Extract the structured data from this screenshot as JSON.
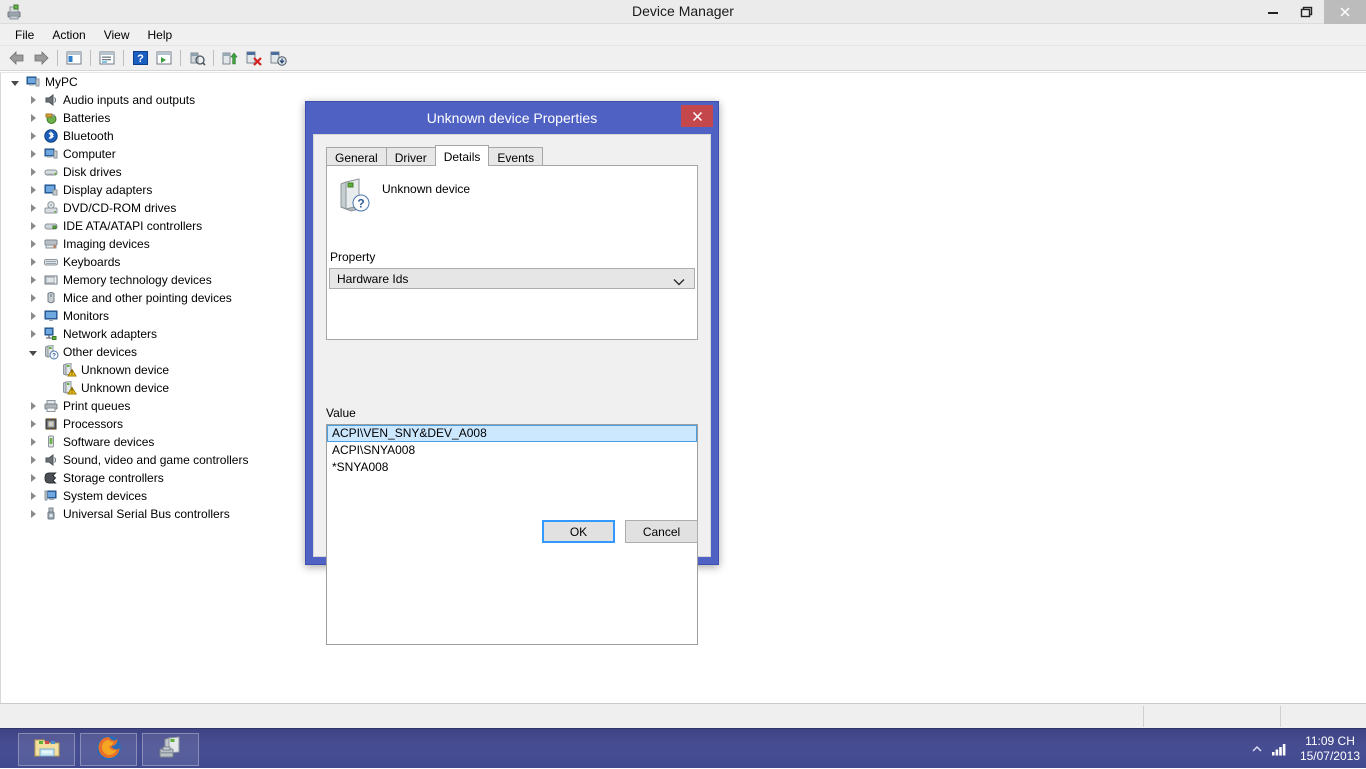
{
  "window": {
    "title": "Device Manager",
    "app_icon": "device-manager-icon",
    "controls": {
      "minimize": "–",
      "maximize": "❐",
      "close": "✕"
    }
  },
  "menubar": {
    "items": [
      {
        "label": "File"
      },
      {
        "label": "Action"
      },
      {
        "label": "View"
      },
      {
        "label": "Help"
      }
    ]
  },
  "toolbar": {
    "items": [
      {
        "name": "back-icon"
      },
      {
        "name": "forward-icon"
      },
      {
        "name": "separator"
      },
      {
        "name": "show-hide-console-tree-icon"
      },
      {
        "name": "separator"
      },
      {
        "name": "properties-icon"
      },
      {
        "name": "separator"
      },
      {
        "name": "help-icon"
      },
      {
        "name": "scan-for-hardware-changes-icon"
      },
      {
        "name": "separator"
      },
      {
        "name": "update-driver-icon"
      },
      {
        "name": "separator"
      },
      {
        "name": "enable-device-icon"
      },
      {
        "name": "disable-device-icon"
      },
      {
        "name": "uninstall-device-icon"
      }
    ]
  },
  "tree": {
    "root": {
      "label": "MyPC",
      "icon": "computer-icon",
      "expanded": true
    },
    "items": [
      {
        "label": "Audio inputs and outputs",
        "icon": "speaker-icon",
        "expanded": false,
        "indent": 1
      },
      {
        "label": "Batteries",
        "icon": "battery-icon",
        "expanded": false,
        "indent": 1
      },
      {
        "label": "Bluetooth",
        "icon": "bluetooth-icon",
        "expanded": false,
        "indent": 1
      },
      {
        "label": "Computer",
        "icon": "computer-icon",
        "expanded": false,
        "indent": 1
      },
      {
        "label": "Disk drives",
        "icon": "disk-drive-icon",
        "expanded": false,
        "indent": 1
      },
      {
        "label": "Display adapters",
        "icon": "display-adapter-icon",
        "expanded": false,
        "indent": 1
      },
      {
        "label": "DVD/CD-ROM drives",
        "icon": "dvd-drive-icon",
        "expanded": false,
        "indent": 1
      },
      {
        "label": "IDE ATA/ATAPI controllers",
        "icon": "ide-controller-icon",
        "expanded": false,
        "indent": 1
      },
      {
        "label": "Imaging devices",
        "icon": "imaging-device-icon",
        "expanded": false,
        "indent": 1
      },
      {
        "label": "Keyboards",
        "icon": "keyboard-icon",
        "expanded": false,
        "indent": 1
      },
      {
        "label": "Memory technology devices",
        "icon": "memory-device-icon",
        "expanded": false,
        "indent": 1
      },
      {
        "label": "Mice and other pointing devices",
        "icon": "mouse-icon",
        "expanded": false,
        "indent": 1
      },
      {
        "label": "Monitors",
        "icon": "monitor-icon",
        "expanded": false,
        "indent": 1
      },
      {
        "label": "Network adapters",
        "icon": "network-adapter-icon",
        "expanded": false,
        "indent": 1
      },
      {
        "label": "Other devices",
        "icon": "unknown-device-icon",
        "expanded": true,
        "indent": 1
      },
      {
        "label": "Unknown device",
        "icon": "warning-device-icon",
        "expanded": null,
        "indent": 2
      },
      {
        "label": "Unknown device",
        "icon": "warning-device-icon",
        "expanded": null,
        "indent": 2
      },
      {
        "label": "Print queues",
        "icon": "printer-icon",
        "expanded": false,
        "indent": 1
      },
      {
        "label": "Processors",
        "icon": "processor-icon",
        "expanded": false,
        "indent": 1
      },
      {
        "label": "Software devices",
        "icon": "software-device-icon",
        "expanded": false,
        "indent": 1
      },
      {
        "label": "Sound, video and game controllers",
        "icon": "speaker-icon",
        "expanded": false,
        "indent": 1
      },
      {
        "label": "Storage controllers",
        "icon": "storage-controller-icon",
        "expanded": false,
        "indent": 1
      },
      {
        "label": "System devices",
        "icon": "system-device-icon",
        "expanded": false,
        "indent": 1
      },
      {
        "label": "Universal Serial Bus controllers",
        "icon": "usb-controller-icon",
        "expanded": false,
        "indent": 1
      }
    ]
  },
  "dialog": {
    "title": "Unknown device Properties",
    "close_label": "✕",
    "tabs": [
      {
        "label": "General",
        "active": false
      },
      {
        "label": "Driver",
        "active": false
      },
      {
        "label": "Details",
        "active": true
      },
      {
        "label": "Events",
        "active": false
      }
    ],
    "device_name": "Unknown device",
    "device_icon": "unknown-device-icon",
    "property_label": "Property",
    "property_selected": "Hardware Ids",
    "value_label": "Value",
    "values": [
      {
        "text": "ACPI\\VEN_SNY&DEV_A008",
        "selected": true
      },
      {
        "text": "ACPI\\SNYA008",
        "selected": false
      },
      {
        "text": "*SNYA008",
        "selected": false
      }
    ],
    "ok_label": "OK",
    "cancel_label": "Cancel"
  },
  "statusbar": {
    "text": ""
  },
  "taskbar": {
    "buttons": [
      {
        "name": "file-explorer-icon"
      },
      {
        "name": "firefox-icon"
      },
      {
        "name": "device-manager-icon"
      }
    ],
    "tray": {
      "show_hidden_icons": "show-hidden-icons-icon",
      "network_icon": "network-signal-icon",
      "time": "11:09 CH",
      "date": "15/07/2013"
    }
  },
  "colors": {
    "dialog_border": "#4f62c4",
    "close_red": "#c4474b",
    "selection_blue": "#cce8ff",
    "taskbar": "#474d92"
  }
}
